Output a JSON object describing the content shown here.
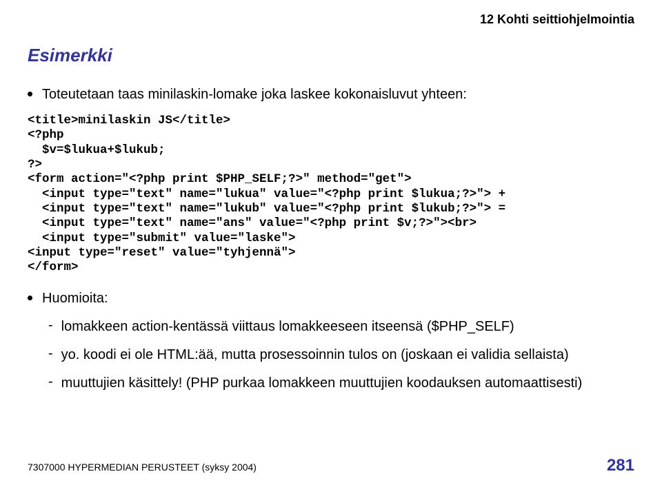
{
  "header": {
    "chapter": "12 Kohti seittiohjelmointia"
  },
  "title": "Esimerkki",
  "bullet1": "Toteutetaan taas minilaskin-lomake joka laskee kokonaisluvut yhteen:",
  "code": "<title>minilaskin JS</title>\n<?php\n  $v=$lukua+$lukub;\n?>\n<form action=\"<?php print $PHP_SELF;?>\" method=\"get\">\n  <input type=\"text\" name=\"lukua\" value=\"<?php print $lukua;?>\"> +\n  <input type=\"text\" name=\"lukub\" value=\"<?php print $lukub;?>\"> =\n  <input type=\"text\" name=\"ans\" value=\"<?php print $v;?>\"><br>\n  <input type=\"submit\" value=\"laske\">\n<input type=\"reset\" value=\"tyhjennä\">\n</form>",
  "bullet2": "Huomioita:",
  "sub": {
    "s1": "lomakkeen action-kentässä viittaus lomakkeeseen itseensä ($PHP_SELF)",
    "s2": "yo. koodi ei ole HTML:ää, mutta prosessoinnin tulos on (joskaan ei validia sellaista)",
    "s3": "muuttujien käsittely! (PHP purkaa lomakkeen muuttujien koodauksen automaattisesti)"
  },
  "footer": {
    "course": "7307000 HYPERMEDIAN PERUSTEET (syksy 2004)",
    "page": "281"
  }
}
